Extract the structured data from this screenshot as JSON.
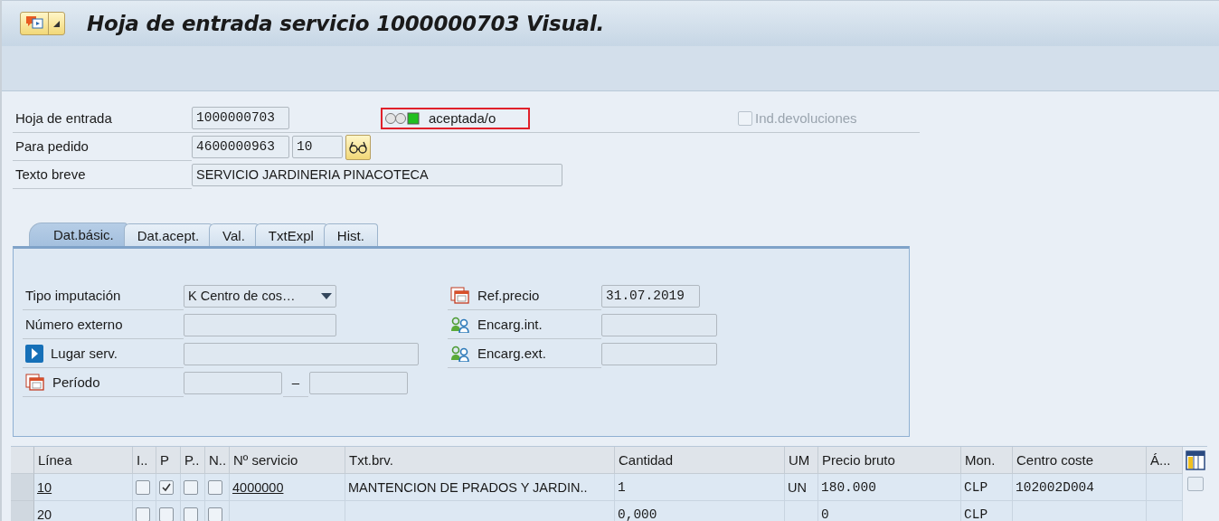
{
  "window": {
    "title": "Hoja de entrada servicio 1000000703 Visual."
  },
  "header": {
    "entry_sheet": {
      "label": "Hoja de entrada",
      "value": "1000000703"
    },
    "status": {
      "lights": [
        {
          "lit": false
        },
        {
          "lit": false
        },
        {
          "lit": true
        }
      ],
      "text": "aceptada/o"
    },
    "returns": {
      "label": "Ind.devoluciones",
      "checked": false,
      "disabled": true
    },
    "order": {
      "label": "Para pedido",
      "value": "4600000963",
      "item": "10"
    },
    "short_text": {
      "label": "Texto breve",
      "value": "SERVICIO JARDINERIA PINACOTECA"
    }
  },
  "tabs": [
    {
      "label": "Dat.básic.",
      "selected": true
    },
    {
      "label": "Dat.acept.",
      "selected": false
    },
    {
      "label": "Val.",
      "selected": false
    },
    {
      "label": "TxtExpl",
      "selected": false
    },
    {
      "label": "Hist.",
      "selected": false
    }
  ],
  "left_fields": [
    {
      "kind": "dropdown",
      "label": "Tipo imputación",
      "value": "K Centro de cos…"
    },
    {
      "kind": "text",
      "label": "Número externo"
    },
    {
      "kind": "link",
      "label": "Lugar serv."
    },
    {
      "kind": "range",
      "label": "Período",
      "separator": "–"
    }
  ],
  "right_fields": [
    {
      "kind": "date",
      "label": "Ref.precio",
      "value": "31.07.2019"
    },
    {
      "kind": "person",
      "label": "Encarg.int."
    },
    {
      "kind": "person",
      "label": "Encarg.ext."
    }
  ],
  "table": {
    "columns": [
      {
        "label": "Línea",
        "kind": "text"
      },
      {
        "label": "I..",
        "kind": "check"
      },
      {
        "label": "P",
        "kind": "check"
      },
      {
        "label": "P..",
        "kind": "check"
      },
      {
        "label": "N..",
        "kind": "check"
      },
      {
        "label": "Nº servicio",
        "kind": "text"
      },
      {
        "label": "Txt.brv.",
        "kind": "text"
      },
      {
        "label": "Cantidad",
        "kind": "mono"
      },
      {
        "label": "UM",
        "kind": "text"
      },
      {
        "label": "Precio bruto",
        "kind": "mono"
      },
      {
        "label": "Mon.",
        "kind": "mono"
      },
      {
        "label": "Centro coste",
        "kind": "mono"
      },
      {
        "label": "Á...",
        "kind": "text"
      }
    ],
    "rows": [
      {
        "cells": [
          {
            "text": "10",
            "link": true
          },
          {
            "checked": false
          },
          {
            "checked": true
          },
          {
            "checked": false
          },
          {
            "checked": false
          },
          {
            "text": "4000000",
            "link": true
          },
          {
            "text": "MANTENCION DE PRADOS Y JARDIN.."
          },
          {
            "text": "1"
          },
          {
            "text": "UN"
          },
          {
            "text": "180.000"
          },
          {
            "text": "CLP"
          },
          {
            "text": "102002D004"
          },
          {}
        ]
      },
      {
        "cells": [
          {
            "text": "20"
          },
          {
            "checked": false
          },
          {
            "checked": false
          },
          {
            "checked": false
          },
          {
            "checked": false
          },
          {},
          {},
          {
            "text": "0,000"
          },
          {},
          {
            "text": "0"
          },
          {
            "text": "CLP"
          },
          {},
          {}
        ]
      }
    ]
  }
}
